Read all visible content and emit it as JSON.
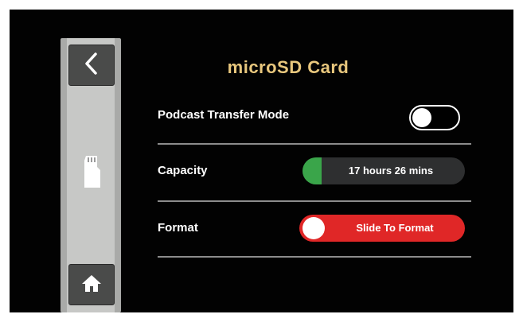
{
  "screen": {
    "title": "microSD Card",
    "title_color": "#e8c77d"
  },
  "sidebar": {
    "back_icon": "chevron-left-icon",
    "device_icon": "microsd-card-icon",
    "home_icon": "home-icon"
  },
  "rows": {
    "podcast_transfer": {
      "label": "Podcast Transfer Mode",
      "toggle_state": "off"
    },
    "capacity": {
      "label": "Capacity",
      "value": "17 hours 26 mins",
      "fill_fraction": 0.12,
      "fill_color": "#3aa54a"
    },
    "format": {
      "label": "Format",
      "slider_text": "Slide To Format",
      "slider_color": "#e02727"
    }
  }
}
